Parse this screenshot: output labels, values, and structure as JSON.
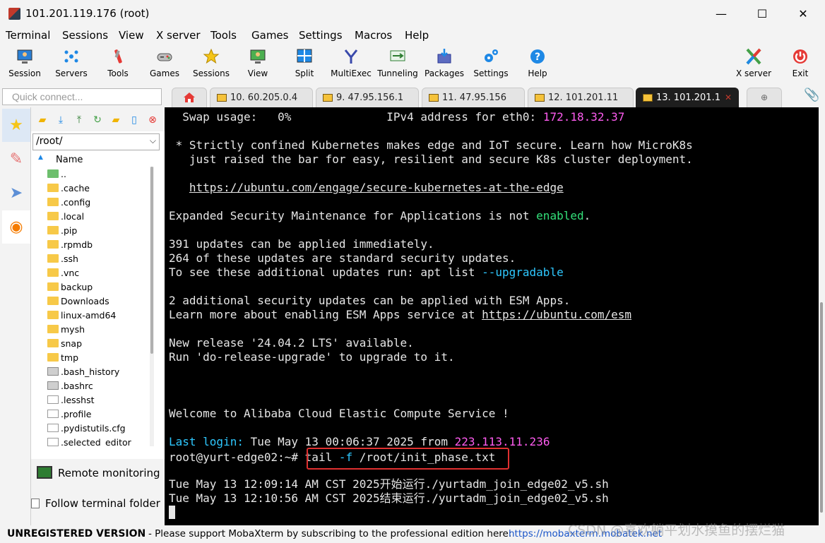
{
  "window": {
    "title": "101.201.119.176 (root)",
    "minimize": "—",
    "maximize": "☐",
    "close": "✕"
  },
  "menu": [
    "Terminal",
    "Sessions",
    "View",
    "X server",
    "Tools",
    "Games",
    "Settings",
    "Macros",
    "Help"
  ],
  "toolbar": {
    "left": [
      {
        "label": "Session",
        "icon": "session-icon"
      },
      {
        "label": "Servers",
        "icon": "servers-icon"
      },
      {
        "label": "Tools",
        "icon": "tools-icon"
      },
      {
        "label": "Games",
        "icon": "games-icon"
      },
      {
        "label": "Sessions",
        "icon": "sessions-star-icon"
      },
      {
        "label": "View",
        "icon": "view-icon"
      },
      {
        "label": "Split",
        "icon": "split-icon"
      },
      {
        "label": "MultiExec",
        "icon": "multiexec-icon"
      },
      {
        "label": "Tunneling",
        "icon": "tunneling-icon"
      },
      {
        "label": "Packages",
        "icon": "packages-icon"
      },
      {
        "label": "Settings",
        "icon": "settings-icon"
      },
      {
        "label": "Help",
        "icon": "help-icon"
      }
    ],
    "right": [
      {
        "label": "X server",
        "icon": "x-server-icon"
      },
      {
        "label": "Exit",
        "icon": "exit-icon"
      }
    ]
  },
  "quick_connect": {
    "placeholder": "Quick connect..."
  },
  "tabs": [
    {
      "label": "10. 60.205.0.4"
    },
    {
      "label": "9. 47.95.156.1"
    },
    {
      "label": "11. 47.95.156"
    },
    {
      "label": "12. 101.201.11"
    },
    {
      "label": "13. 101.201.1"
    }
  ],
  "sidebar": {
    "path": "/root/",
    "column_header": "Name",
    "files": [
      {
        "name": "..",
        "type": "up"
      },
      {
        "name": ".cache",
        "type": "folder"
      },
      {
        "name": ".config",
        "type": "folder"
      },
      {
        "name": ".local",
        "type": "folder"
      },
      {
        "name": ".pip",
        "type": "folder"
      },
      {
        "name": ".rpmdb",
        "type": "folder"
      },
      {
        "name": ".ssh",
        "type": "folder"
      },
      {
        "name": ".vnc",
        "type": "folder"
      },
      {
        "name": "backup",
        "type": "folder"
      },
      {
        "name": "Downloads",
        "type": "folder"
      },
      {
        "name": "linux-amd64",
        "type": "folder"
      },
      {
        "name": "mysh",
        "type": "folder"
      },
      {
        "name": "snap",
        "type": "folder"
      },
      {
        "name": "tmp",
        "type": "folder"
      },
      {
        "name": ".bash_history",
        "type": "hist"
      },
      {
        "name": ".bashrc",
        "type": "hist"
      },
      {
        "name": ".lesshst",
        "type": "doc"
      },
      {
        "name": ".profile",
        "type": "doc"
      },
      {
        "name": ".pydistutils.cfg",
        "type": "doc"
      },
      {
        "name": ".selected_editor",
        "type": "doc"
      }
    ],
    "remote_monitoring": "Remote monitoring",
    "follow_folder": "Follow terminal folder"
  },
  "terminal": {
    "swap_label": "  Swap usage:   0%",
    "ipv4_label": "IPv4 address for eth0: ",
    "ipv4_value": "172.18.32.37",
    "microk8s_1": " * Strictly confined Kubernetes makes edge and IoT secure. Learn how MicroK8s",
    "microk8s_2": "   just raised the bar for easy, resilient and secure K8s cluster deployment.",
    "microk8s_url": "https://ubuntu.com/engage/secure-kubernetes-at-the-edge",
    "esm_text": "Expanded Security Maintenance for Applications is not ",
    "esm_enabled": "enabled",
    "esm_dot": ".",
    "updates_1": "391 updates can be applied immediately.",
    "updates_2": "264 of these updates are standard security updates.",
    "updates_3_text": "To see these additional updates run: apt list ",
    "updates_3_flag": "--upgradable",
    "esm_apps_1": "2 additional security updates can be applied with ESM Apps.",
    "esm_apps_2_text": "Learn more about enabling ESM Apps service at ",
    "esm_apps_2_url": "https://ubuntu.com/esm",
    "release_1": "New release '24.04.2 LTS' available.",
    "release_2": "Run 'do-release-upgrade' to upgrade to it.",
    "welcome": "Welcome to Alibaba Cloud Elastic Compute Service !",
    "lastlogin_label": "Last login:",
    "lastlogin_text": " Tue May 13 00:06:37 2025 from ",
    "lastlogin_ip": "223.113.11.236",
    "prompt": "root@yurt-edge02:~#",
    "cmd_tail": "tail ",
    "cmd_flag": "-f",
    "cmd_path": " /root/init_phase.txt",
    "out_1": "Tue May 13 12:09:14 AM CST 2025开始运行./yurtadm_join_edge02_v5.sh",
    "out_2": "Tue May 13 12:10:56 AM CST 2025结束运行./yurtadm_join_edge02_v5.sh"
  },
  "status": {
    "unregistered": "UNREGISTERED VERSION",
    "message": "-   Please support MobaXterm by subscribing to the professional edition here:",
    "link": "https://mobaxterm.mobatek.net"
  },
  "watermark": "CSDN @喜欢躺平划水摸鱼的摆烂猫",
  "colors": {
    "terminal_bg": "#000000",
    "green": "#33e07a",
    "magenta": "#ff5cf0",
    "cyan": "#2ec8ff",
    "highlight": "#e03030"
  }
}
